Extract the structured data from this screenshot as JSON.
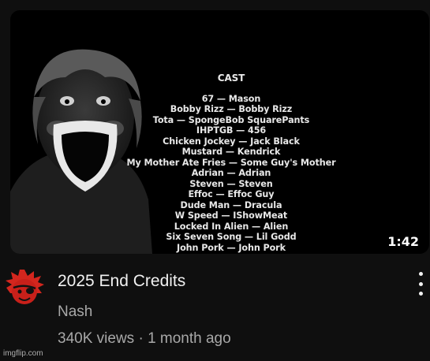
{
  "video": {
    "duration": "1:42",
    "title": "2025 End Credits",
    "channel": "Nash",
    "views": "340K views",
    "separator": " · ",
    "age": "1 month ago"
  },
  "thumbnail": {
    "cast_title": "CAST",
    "cast_lines": [
      "67 — Mason",
      "Bobby Rizz — Bobby Rizz",
      "Tota — SpongeBob SquarePants",
      "IHPTGB — 456",
      "Chicken Jockey — Jack Black",
      "Mustard — Kendrick",
      "My Mother Ate Fries — Some Guy's Mother",
      "Adrian — Adrian",
      "Steven — Steven",
      "Effoc — Effoc Guy",
      "Dude Man — Dracula",
      "W Speed — IShowMeat",
      "Locked In Alien — Alien",
      "Six Seven Song — Lil Godd",
      "John Pork — John Pork"
    ]
  },
  "watermark": "imgflip.com",
  "icons": {
    "more": "more-vert-icon",
    "avatar": "channel-avatar"
  },
  "colors": {
    "background": "#0f0f0f",
    "title": "#f1f1f1",
    "secondary": "#a8a8a8"
  }
}
